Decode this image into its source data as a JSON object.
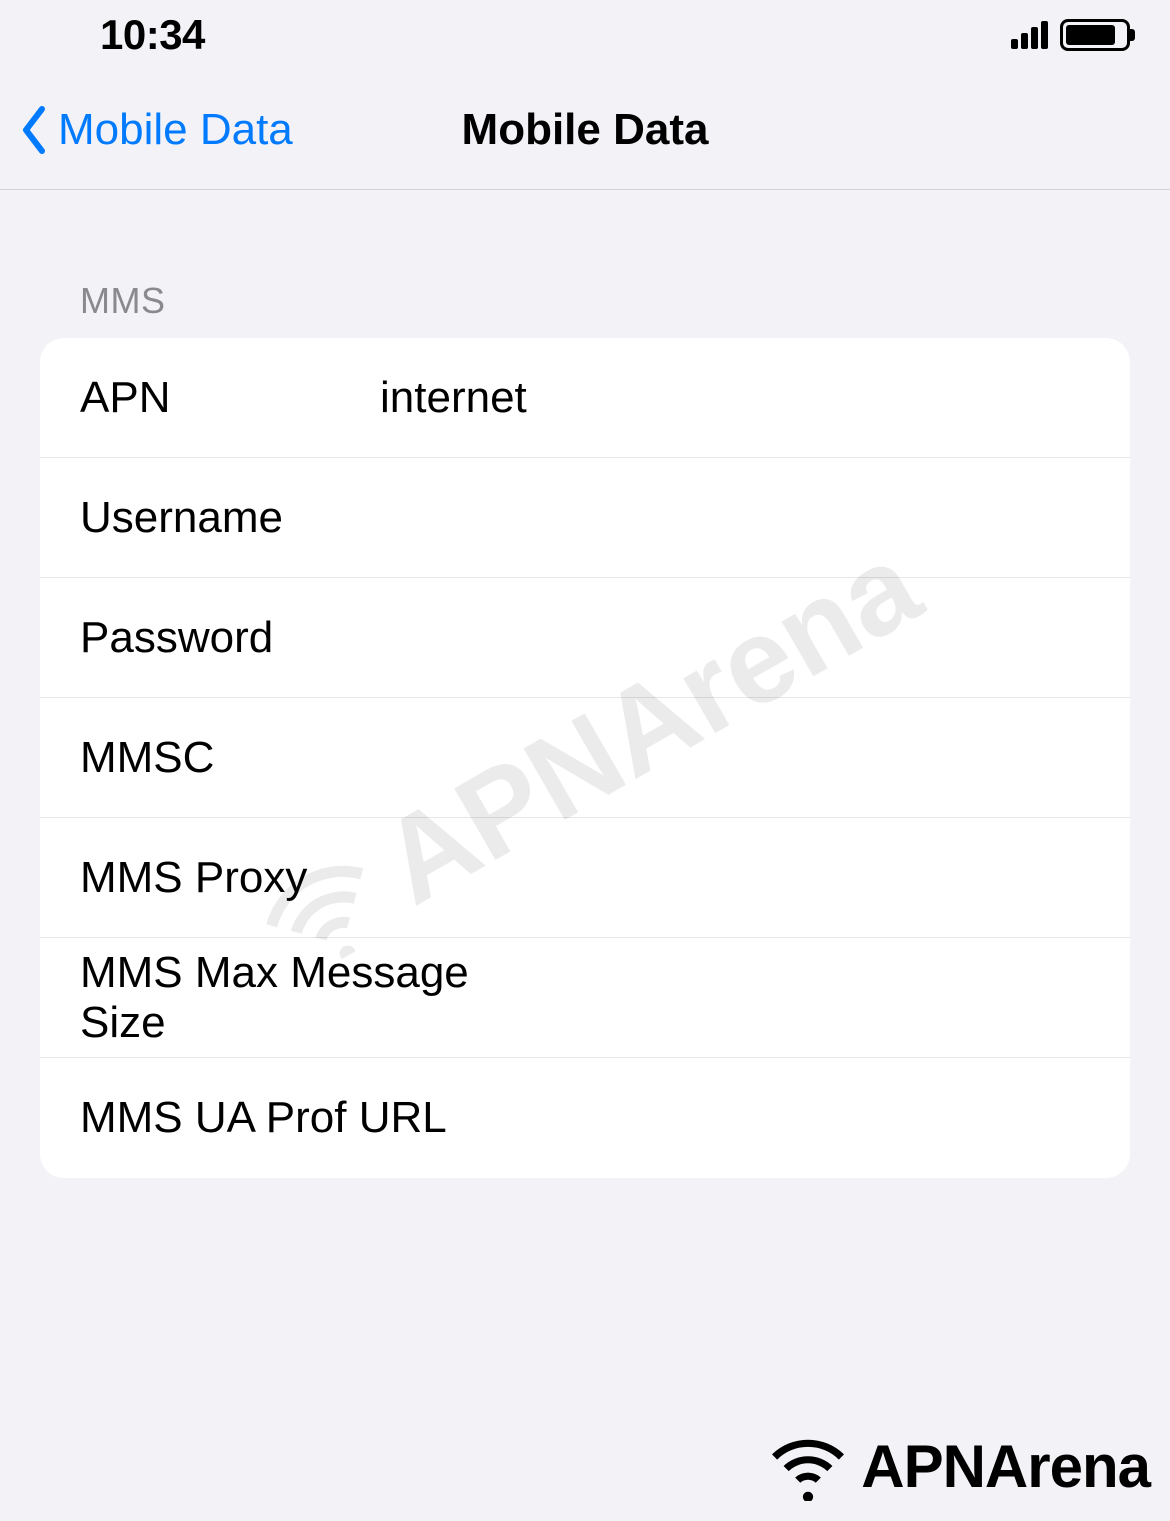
{
  "statusBar": {
    "time": "10:34"
  },
  "nav": {
    "backLabel": "Mobile Data",
    "title": "Mobile Data"
  },
  "section": {
    "header": "MMS",
    "rows": [
      {
        "label": "APN",
        "value": "internet",
        "wide": false
      },
      {
        "label": "Username",
        "value": "",
        "wide": false
      },
      {
        "label": "Password",
        "value": "",
        "wide": false
      },
      {
        "label": "MMSC",
        "value": "",
        "wide": false
      },
      {
        "label": "MMS Proxy",
        "value": "",
        "wide": false
      },
      {
        "label": "MMS Max Message Size",
        "value": "",
        "wide": true
      },
      {
        "label": "MMS UA Prof URL",
        "value": "",
        "wide": true
      }
    ]
  },
  "watermark": {
    "text": "APNArena"
  },
  "footer": {
    "text": "APNArena"
  }
}
